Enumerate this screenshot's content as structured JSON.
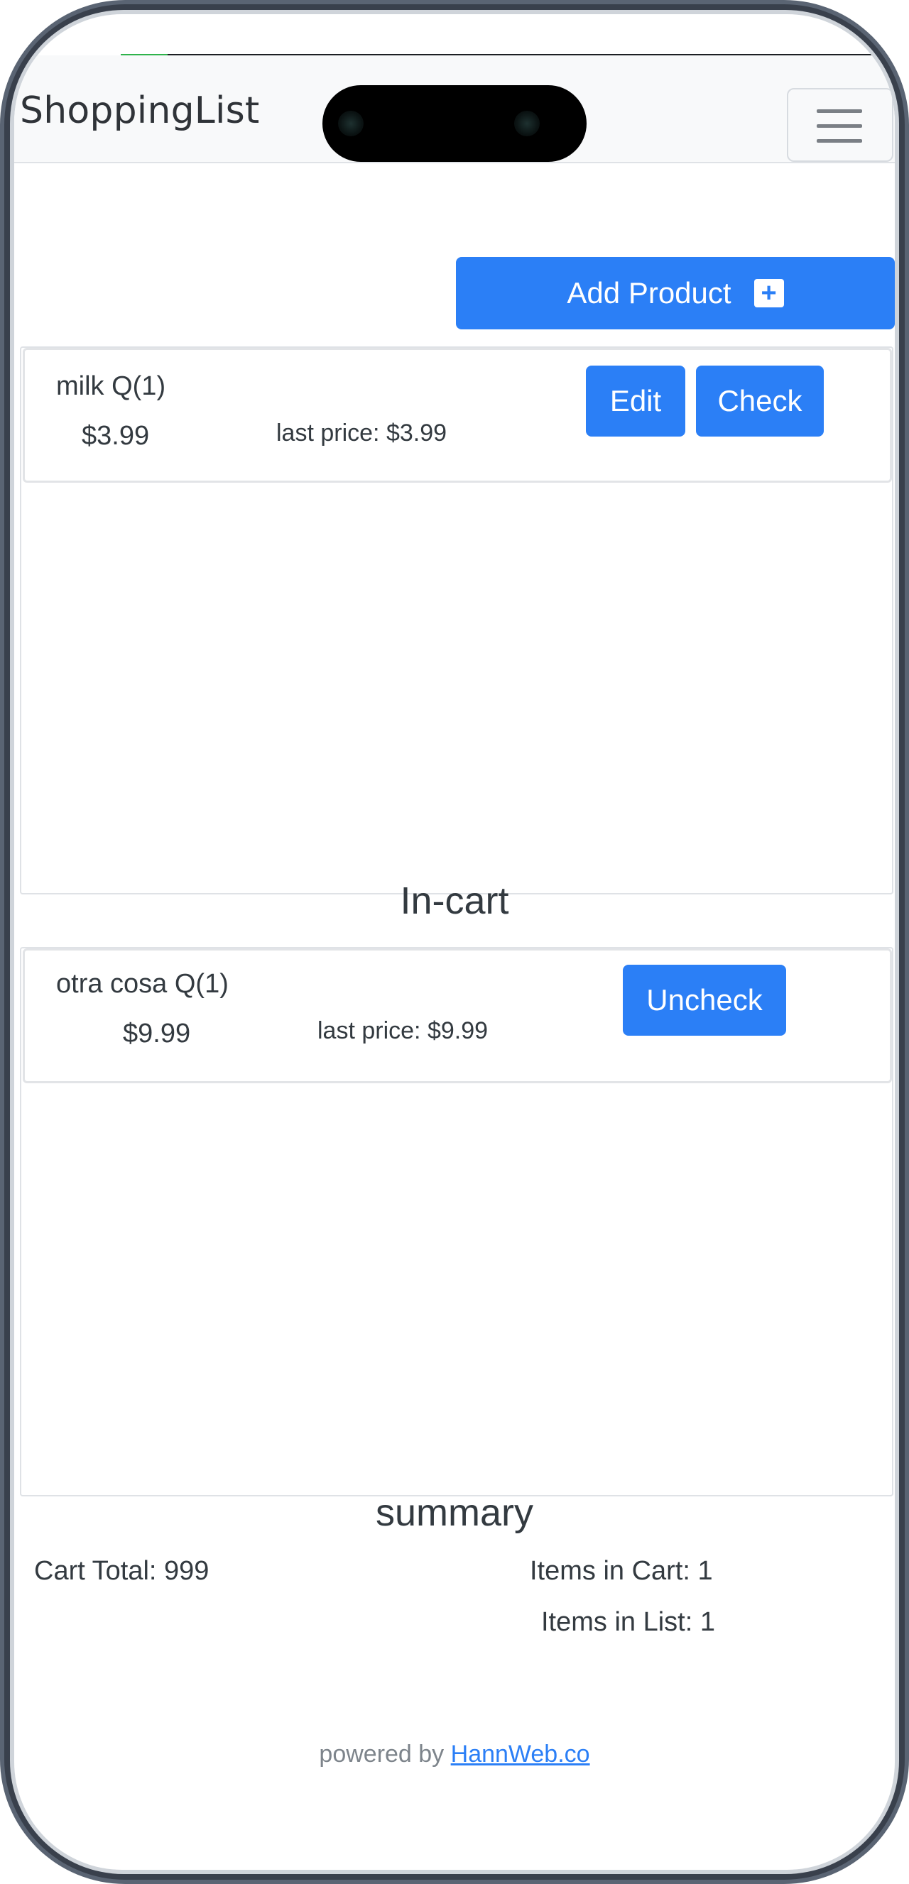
{
  "navbar": {
    "brand": "ShoppingList",
    "menu_icon": "hamburger-menu-icon"
  },
  "actions": {
    "add_product_label": "Add Product",
    "add_icon": "plus-square-icon",
    "add_icon_glyph": "+"
  },
  "list_items": [
    {
      "name": "milk Q(1)",
      "price": "$3.99",
      "last_price": "last price: $3.99",
      "edit_label": "Edit",
      "check_label": "Check"
    }
  ],
  "in_cart": {
    "title": "In-cart",
    "items": [
      {
        "name": "otra cosa Q(1)",
        "price": "$9.99",
        "last_price": "last price: $9.99",
        "uncheck_label": "Uncheck"
      }
    ]
  },
  "summary": {
    "title": "summary",
    "cart_total": "Cart Total: 999",
    "items_in_cart": "Items in Cart: 1",
    "items_in_list": "Items in List: 1"
  },
  "footer": {
    "powered_by": "powered by",
    "link_text": "HannWeb.co"
  },
  "colors": {
    "primary": "#2b7ff6",
    "navbar_bg": "#f8f9fa",
    "text": "#333a40",
    "muted": "#7d848b",
    "frame": "#5a6473"
  }
}
